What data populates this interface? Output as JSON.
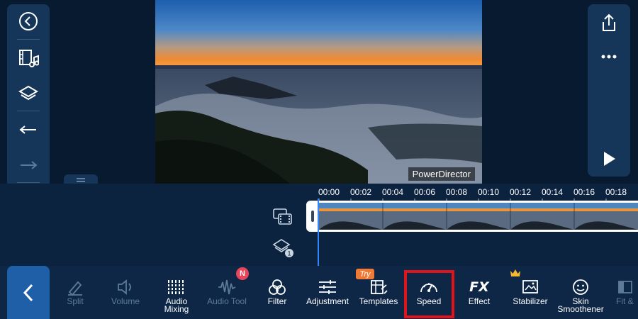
{
  "app": {
    "watermark": "PowerDirector"
  },
  "left_panel": {
    "items": [
      {
        "icon": "back-circle-icon"
      },
      {
        "icon": "media-music-icon"
      },
      {
        "icon": "layers-icon"
      },
      {
        "icon": "undo-icon"
      },
      {
        "icon": "redo-icon"
      },
      {
        "icon": "trash-icon"
      }
    ]
  },
  "right_panel": {
    "items": [
      {
        "icon": "share-icon"
      },
      {
        "icon": "more-icon"
      },
      {
        "icon": "play-icon"
      }
    ]
  },
  "timeline": {
    "ticks": [
      "00:00",
      "00:02",
      "00:04",
      "00:06",
      "00:08",
      "00:10",
      "00:12",
      "00:14",
      "00:16",
      "00:18"
    ],
    "tracks": [
      {
        "icon": "video-track-icon"
      },
      {
        "icon": "overlay-track-icon",
        "count": "1"
      }
    ]
  },
  "toolbar": {
    "back_icon": "chevron-left-icon",
    "items": [
      {
        "label": "Split",
        "icon": "split-icon",
        "enabled": false
      },
      {
        "label": "Volume",
        "icon": "volume-icon",
        "enabled": false
      },
      {
        "label": "Audio\nMixing",
        "icon": "audio-mixing-icon",
        "enabled": true
      },
      {
        "label": "Audio Tool",
        "icon": "audio-tool-icon",
        "enabled": false,
        "badge": "N"
      },
      {
        "label": "Filter",
        "icon": "filter-icon",
        "enabled": true
      },
      {
        "label": "Adjustment",
        "icon": "adjustment-icon",
        "enabled": true
      },
      {
        "label": "Templates",
        "icon": "templates-icon",
        "enabled": true,
        "badge": "Try"
      },
      {
        "label": "Speed",
        "icon": "speed-icon",
        "enabled": true,
        "highlighted": true
      },
      {
        "label": "Effect",
        "icon": "fx-icon",
        "enabled": true,
        "icon_text": "FX"
      },
      {
        "label": "Stabilizer",
        "icon": "stabilizer-icon",
        "enabled": true,
        "premium": true
      },
      {
        "label": "Skin\nSmoothener",
        "icon": "skin-smoothener-icon",
        "enabled": true
      },
      {
        "label": "Fit &",
        "icon": "fit-fill-icon",
        "enabled": false
      }
    ]
  },
  "colors": {
    "background": "#071a30",
    "panel": "#163659",
    "accent": "#1f5fa8",
    "playhead": "#2f86ff",
    "highlight_box": "#e0151b",
    "badge_n": "#e8455a",
    "badge_try": "#f07a35"
  }
}
